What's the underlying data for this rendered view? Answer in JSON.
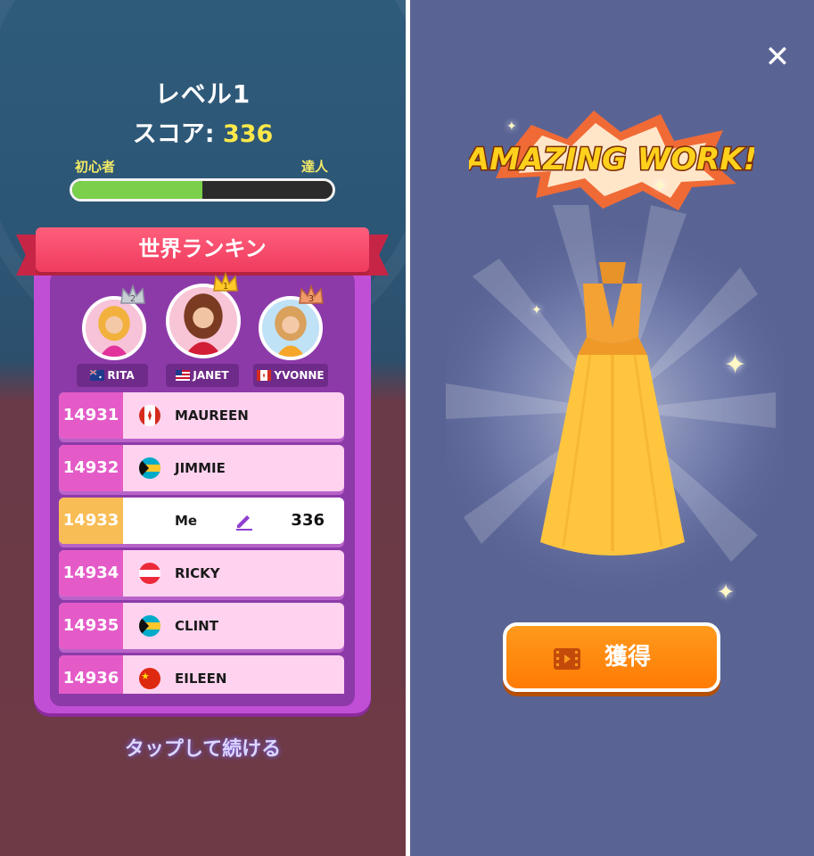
{
  "level": {
    "label": "レベル",
    "number": "1"
  },
  "score": {
    "label": "スコア:",
    "value": "336"
  },
  "progress": {
    "left_label": "初心者",
    "right_label": "達人",
    "fraction": 0.5
  },
  "ranking_title": "世界ランキン",
  "podium": [
    {
      "rank": "2",
      "name": "RITA",
      "flag": "australia"
    },
    {
      "rank": "1",
      "name": "JANET",
      "flag": "usa"
    },
    {
      "rank": "3",
      "name": "YVONNE",
      "flag": "canada"
    }
  ],
  "rows": [
    {
      "rank": "14931",
      "name": "MAUREEN",
      "flag": "canada"
    },
    {
      "rank": "14932",
      "name": "JIMMIE",
      "flag": "bahamas"
    },
    {
      "rank": "14933",
      "name": "Me",
      "score": "336",
      "me": true
    },
    {
      "rank": "14934",
      "name": "RICKY",
      "flag": "austria"
    },
    {
      "rank": "14935",
      "name": "CLINT",
      "flag": "bahamas"
    },
    {
      "rank": "14936",
      "name": "EILEEN",
      "flag": "china"
    }
  ],
  "tap_to_continue": "タップして続ける",
  "reward": {
    "banner": "AMAZING WORK!",
    "claim_label": "獲得"
  },
  "colors": {
    "accent_orange": "#ff7b05",
    "ranking_purple": "#c14fd6",
    "progress_green": "#7ad04a"
  }
}
